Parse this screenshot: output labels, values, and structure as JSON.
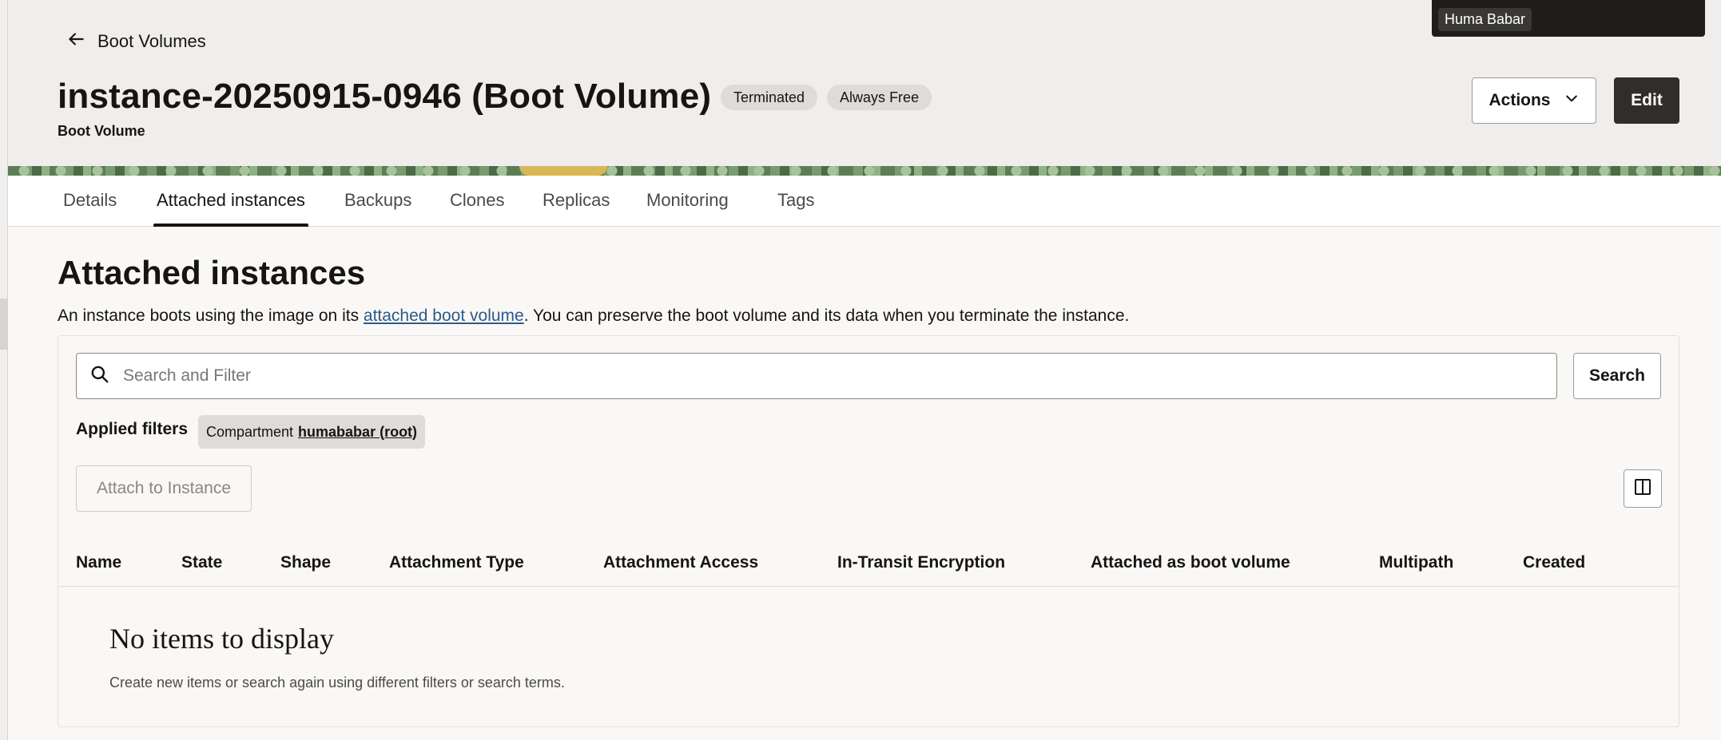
{
  "breadcrumb": {
    "back_label": "Boot Volumes"
  },
  "header": {
    "title": "instance-20250915-0946 (Boot Volume)",
    "subtitle": "Boot Volume",
    "badges": [
      "Terminated",
      "Always Free"
    ],
    "actions_label": "Actions",
    "edit_label": "Edit"
  },
  "user": {
    "name": "Huma Babar"
  },
  "tabs": [
    {
      "label": "Details"
    },
    {
      "label": "Attached instances"
    },
    {
      "label": "Backups"
    },
    {
      "label": "Clones"
    },
    {
      "label": "Replicas"
    },
    {
      "label": "Monitoring"
    },
    {
      "label": "Tags"
    }
  ],
  "active_tab": "Attached instances",
  "section": {
    "title": "Attached instances",
    "desc_prefix": "An instance boots using the image on its ",
    "desc_link": "attached boot volume",
    "desc_suffix": ". You can preserve the boot volume and its data when you terminate the instance."
  },
  "search": {
    "placeholder": "Search and Filter",
    "button_label": "Search"
  },
  "filters": {
    "label": "Applied filters",
    "chips": [
      {
        "key": "Compartment",
        "value": "humababar (root)"
      }
    ]
  },
  "toolbar": {
    "attach_label": "Attach to Instance"
  },
  "table": {
    "columns": [
      "Name",
      "State",
      "Shape",
      "Attachment Type",
      "Attachment Access",
      "In-Transit Encryption",
      "Attached as boot volume",
      "Multipath",
      "Created"
    ],
    "rows": []
  },
  "empty_state": {
    "title": "No items to display",
    "description": "Create new items or search again using different filters or search terms."
  }
}
